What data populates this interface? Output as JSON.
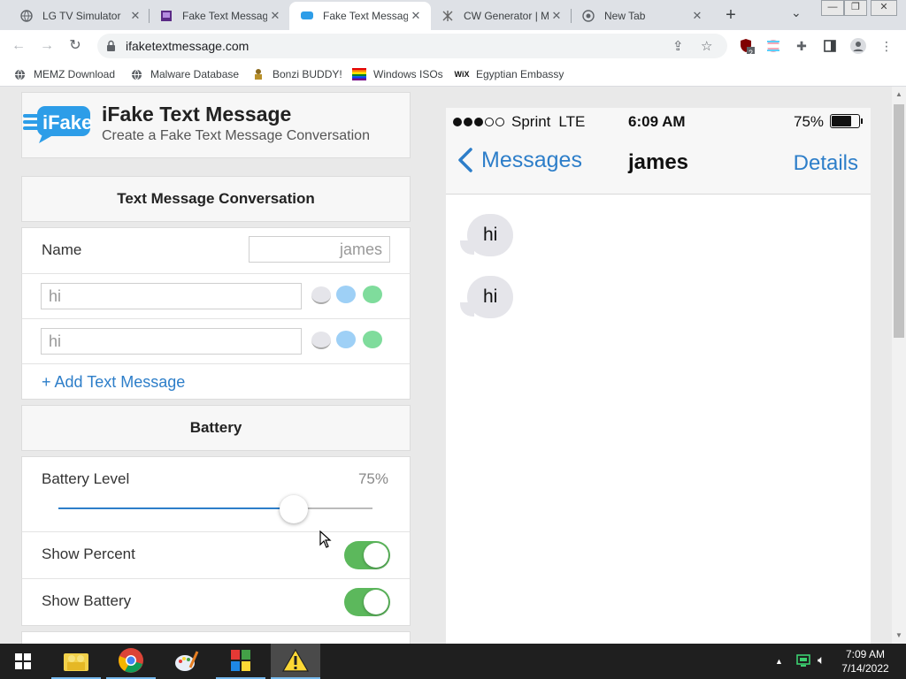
{
  "browser": {
    "tabs": [
      {
        "title": "LG TV Simulator",
        "icon": "globe-icon"
      },
      {
        "title": "Fake Text Message",
        "icon": "purple-site-icon"
      },
      {
        "title": "Fake Text Message",
        "icon": "ifake-icon"
      },
      {
        "title": "CW Generator | M",
        "icon": "cw-icon"
      },
      {
        "title": "New Tab",
        "icon": "chrome-icon"
      }
    ],
    "active_tab": 2,
    "url": "ifaketextmessage.com",
    "extension_badge": "2",
    "bookmarks": [
      {
        "label": "MEMZ Download",
        "icon": "globe-icon"
      },
      {
        "label": "Malware Database",
        "icon": "globe-icon"
      },
      {
        "label": "Bonzi BUDDY!",
        "icon": "bonzi-icon"
      },
      {
        "label": "Windows ISOs",
        "icon": "windows-flag-icon"
      },
      {
        "label": "Egyptian Embassy",
        "icon": "wix-icon"
      }
    ]
  },
  "app": {
    "logo_text": "iFake",
    "title": "iFake Text Message",
    "subtitle": "Create a Fake Text Message Conversation"
  },
  "conversation": {
    "heading": "Text Message Conversation",
    "name_label": "Name",
    "name_value": "james",
    "messages": [
      {
        "text": "hi"
      },
      {
        "text": "hi"
      }
    ],
    "add_label": "+ Add Text Message"
  },
  "battery": {
    "heading": "Battery",
    "level_label": "Battery Level",
    "level_value": "75%",
    "level_fraction": 0.75,
    "show_percent_label": "Show Percent",
    "show_percent_on": true,
    "show_battery_label": "Show Battery",
    "show_battery_on": true
  },
  "phone": {
    "carrier": "Sprint",
    "network": "LTE",
    "signal_bars": 3,
    "signal_total": 5,
    "time": "6:09 AM",
    "battery_pct": "75%",
    "back_label": "Messages",
    "contact": "james",
    "details_label": "Details",
    "bubbles": [
      {
        "text": "hi"
      },
      {
        "text": "hi"
      }
    ]
  },
  "taskbar": {
    "time": "7:09 AM",
    "date": "7/14/2022"
  },
  "colors": {
    "link_blue": "#2d7ec9",
    "toggle_green": "#5cb85c"
  }
}
